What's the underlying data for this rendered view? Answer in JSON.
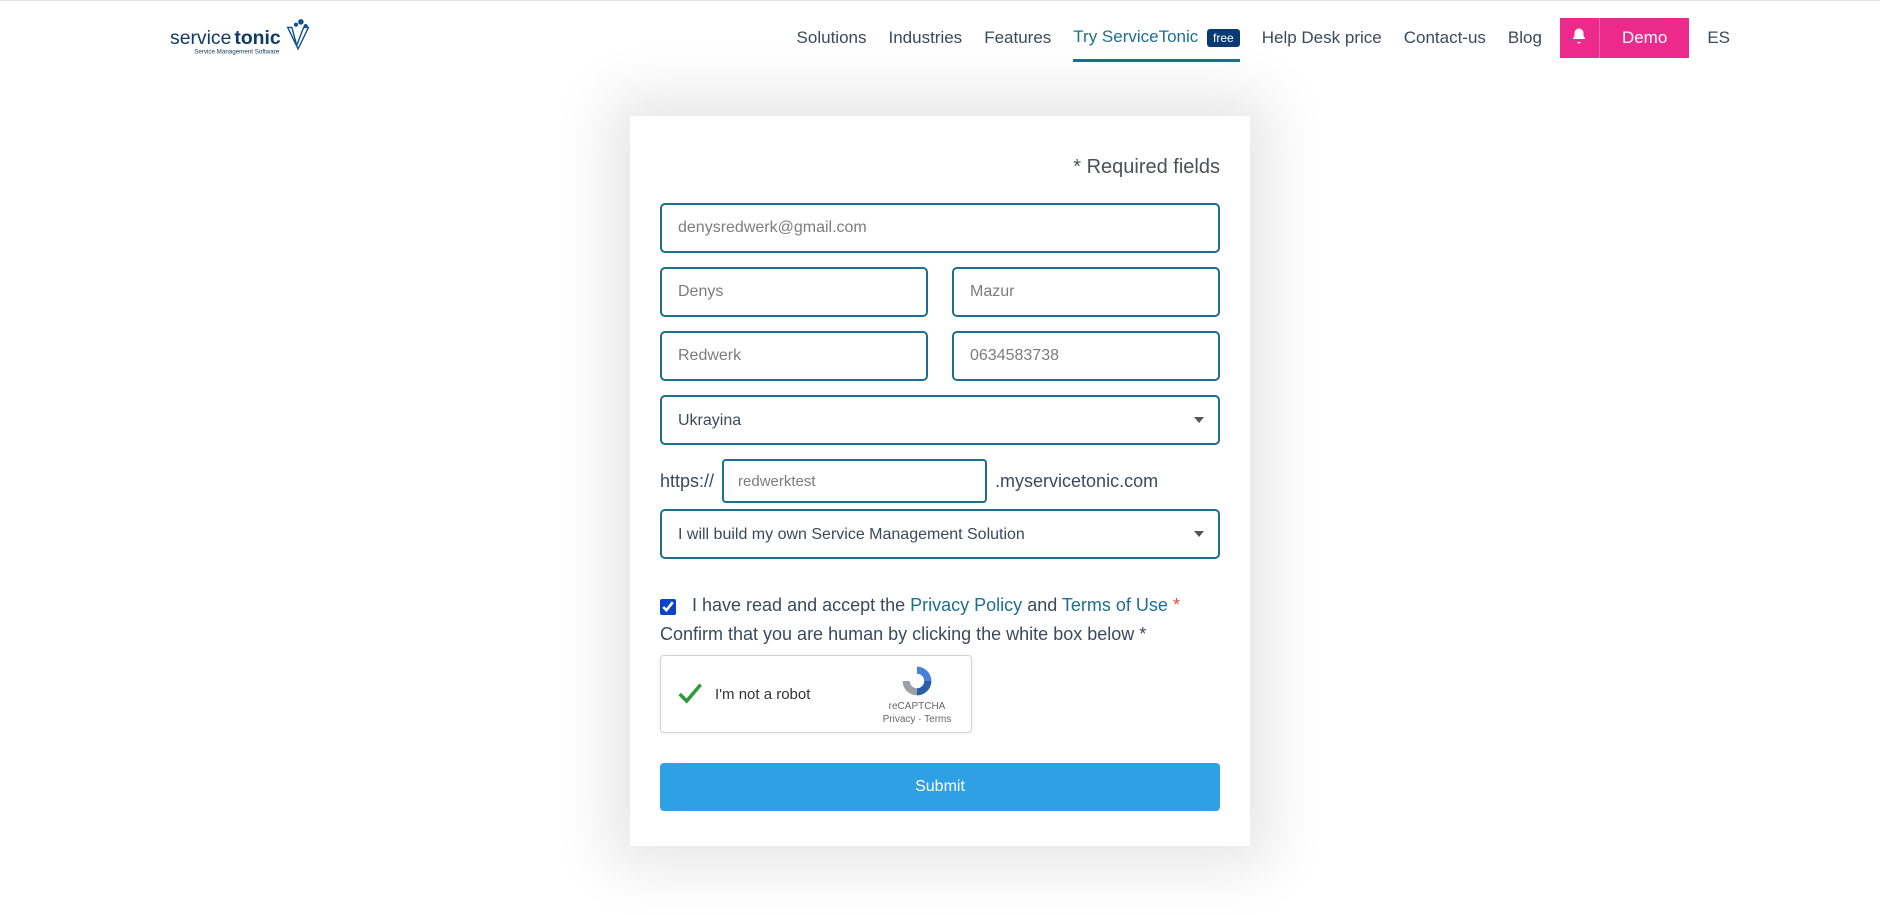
{
  "header": {
    "logo": {
      "brand_a": "service",
      "brand_b": "tonic",
      "tagline": "Service Management Software"
    },
    "nav": {
      "solutions": "Solutions",
      "industries": "Industries",
      "features": "Features",
      "try": "Try ServiceTonic",
      "free": "free",
      "pricing": "Help Desk price",
      "contact": "Contact-us",
      "blog": "Blog"
    },
    "demo": "Demo",
    "lang": "ES"
  },
  "form": {
    "required": "* Required fields",
    "email": "denysredwerk@gmail.com",
    "first_name": "Denys",
    "last_name": "Mazur",
    "company": "Redwerk",
    "phone": "0634583738",
    "country": "Ukrayina",
    "url_prefix": "https://",
    "subdomain": "redwerktest",
    "url_suffix": ".myservicetonic.com",
    "solution": "I will build my own Service Management Solution",
    "consent_a": "I have read and accept the ",
    "privacy": "Privacy Policy",
    "consent_b": " and ",
    "terms": "Terms of Use",
    "confirm": "Confirm that you are human by clicking the white box below *",
    "captcha_label": "I'm not a robot",
    "captcha_brand": "reCAPTCHA",
    "captcha_legal": "Privacy · Terms",
    "submit": "Submit"
  }
}
